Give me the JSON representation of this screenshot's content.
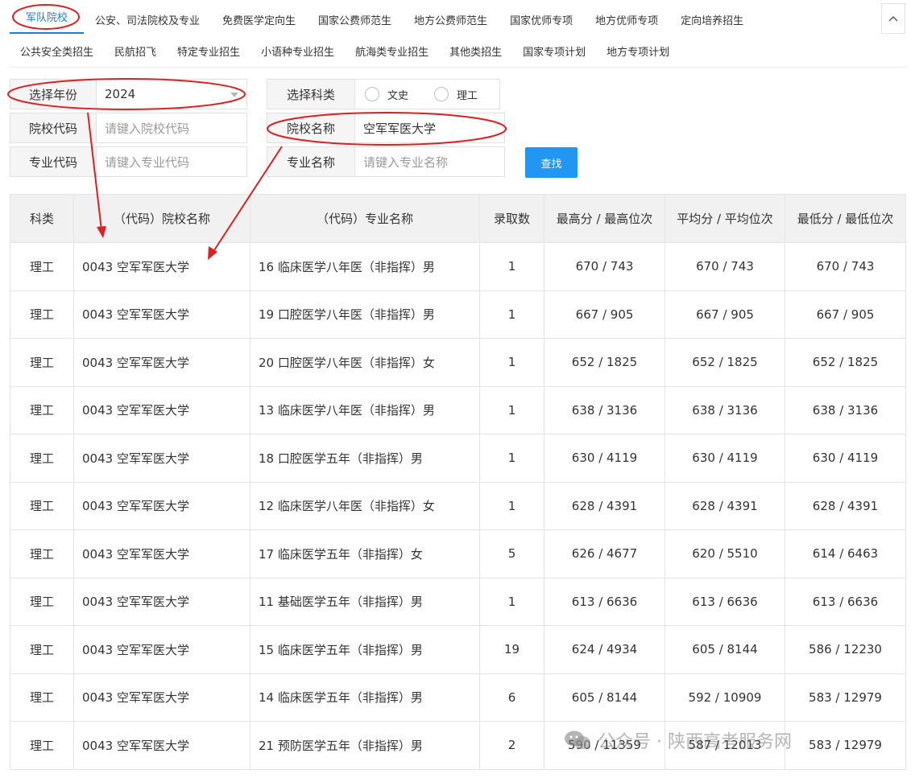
{
  "tabs_row1": [
    "军队院校",
    "公安、司法院校及专业",
    "免费医学定向生",
    "国家公费师范生",
    "地方公费师范生",
    "国家优师专项",
    "地方优师专项",
    "定向培养招生"
  ],
  "tabs_row2": [
    "公共安全类招生",
    "民航招飞",
    "特定专业招生",
    "小语种专业招生",
    "航海类专业招生",
    "其他类招生",
    "国家专项计划",
    "地方专项计划"
  ],
  "collapse_icon": "chevron-up-icon",
  "form": {
    "year_label": "选择年份",
    "year_value": "2024",
    "subject_label": "选择科类",
    "subject_options": [
      "文史",
      "理工"
    ],
    "school_code_label": "院校代码",
    "school_code_placeholder": "请键入院校代码",
    "school_name_label": "院校名称",
    "school_name_value": "空军军医大学",
    "major_code_label": "专业代码",
    "major_code_placeholder": "请键入专业代码",
    "major_name_label": "专业名称",
    "major_name_placeholder": "请键入专业名称",
    "search_label": "查找"
  },
  "table": {
    "headers": [
      "科类",
      "（代码）院校名称",
      "（代码）专业名称",
      "录取数",
      "最高分 / 最高位次",
      "平均分 / 平均位次",
      "最低分 / 最低位次"
    ],
    "rows": [
      [
        "理工",
        "0043 空军军医大学",
        "16 临床医学八年医（非指挥）男",
        "1",
        "670 / 743",
        "670 / 743",
        "670 / 743"
      ],
      [
        "理工",
        "0043 空军军医大学",
        "19 口腔医学八年医（非指挥）男",
        "1",
        "667 / 905",
        "667 / 905",
        "667 / 905"
      ],
      [
        "理工",
        "0043 空军军医大学",
        "20 口腔医学八年医（非指挥）女",
        "1",
        "652 / 1825",
        "652 / 1825",
        "652 / 1825"
      ],
      [
        "理工",
        "0043 空军军医大学",
        "13 临床医学八年医（非指挥）男",
        "1",
        "638 / 3136",
        "638 / 3136",
        "638 / 3136"
      ],
      [
        "理工",
        "0043 空军军医大学",
        "18 口腔医学五年（非指挥）男",
        "1",
        "630 / 4119",
        "630 / 4119",
        "630 / 4119"
      ],
      [
        "理工",
        "0043 空军军医大学",
        "12 临床医学八年医（非指挥）女",
        "1",
        "628 / 4391",
        "628 / 4391",
        "628 / 4391"
      ],
      [
        "理工",
        "0043 空军军医大学",
        "17 临床医学五年（非指挥）女",
        "5",
        "626 / 4677",
        "620 / 5510",
        "614 / 6463"
      ],
      [
        "理工",
        "0043 空军军医大学",
        "11 基础医学五年（非指挥）男",
        "1",
        "613 / 6636",
        "613 / 6636",
        "613 / 6636"
      ],
      [
        "理工",
        "0043 空军军医大学",
        "15 临床医学五年（非指挥）男",
        "19",
        "624 / 4934",
        "605 / 8144",
        "586 / 12230"
      ],
      [
        "理工",
        "0043 空军军医大学",
        "14 临床医学五年（非指挥）男",
        "6",
        "605 / 8144",
        "592 / 10909",
        "583 / 12979"
      ],
      [
        "理工",
        "0043 空军军医大学",
        "21 预防医学五年（非指挥）男",
        "2",
        "590 / 11359",
        "587 / 12013",
        "583 / 12979"
      ]
    ]
  },
  "watermark": "公众号 · 陕西高考服务网",
  "annotation_color": "#e02020"
}
